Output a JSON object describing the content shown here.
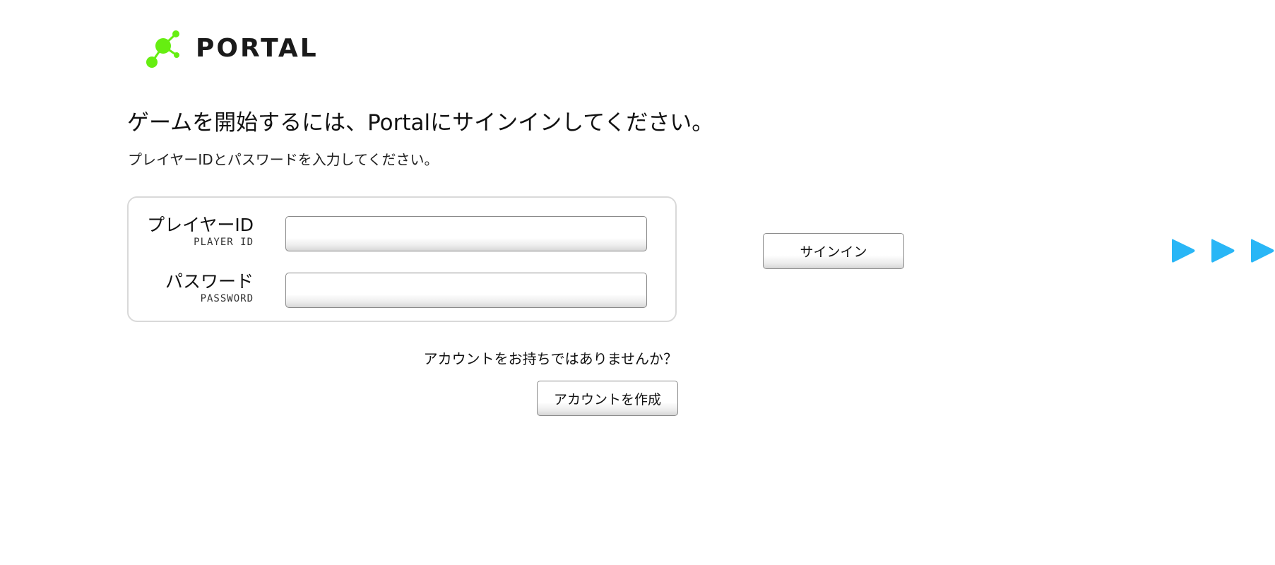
{
  "logo": {
    "text": "PORTAL",
    "brand_color": "#66ee11"
  },
  "heading": "ゲームを開始するには、Portalにサインインしてください。",
  "subheading": "プレイヤーIDとパスワードを入力してください。",
  "form": {
    "player_id": {
      "label": "プレイヤーID",
      "sublabel": "PLAYER ID",
      "value": ""
    },
    "password": {
      "label": "パスワード",
      "sublabel": "PASSWORD",
      "value": ""
    }
  },
  "signin_button": "サインイン",
  "no_account_text": "アカウントをお持ちではありませんか？",
  "create_account_button": "アカウントを作成",
  "arrows": {
    "icon": "play-arrow-icon",
    "color": "#29b6f6",
    "count": 3
  }
}
